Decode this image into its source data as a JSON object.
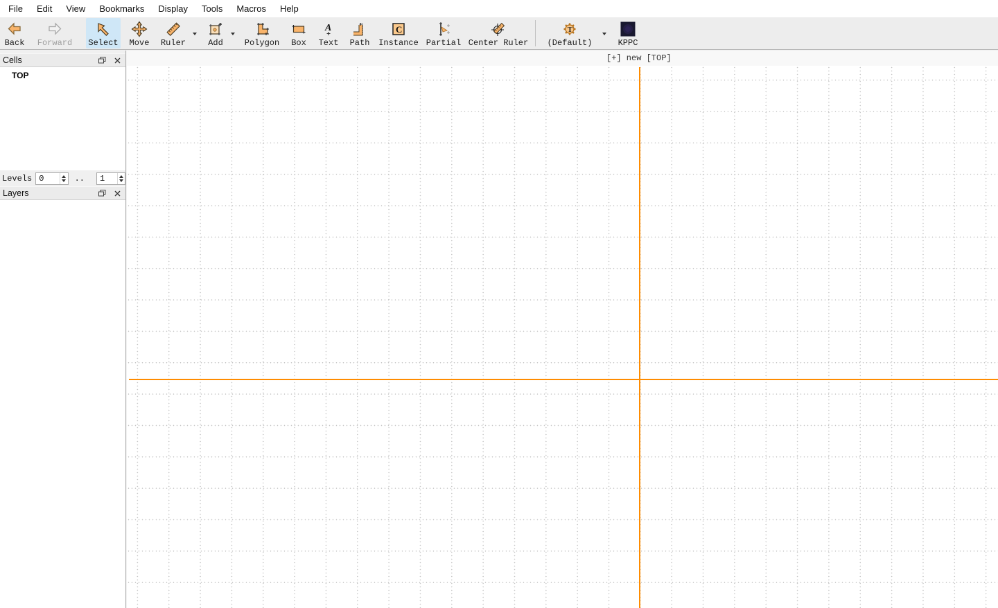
{
  "menu": {
    "items": [
      "File",
      "Edit",
      "View",
      "Bookmarks",
      "Display",
      "Tools",
      "Macros",
      "Help"
    ]
  },
  "toolbar": {
    "buttons": [
      {
        "id": "back",
        "label": "Back",
        "state": "enabled"
      },
      {
        "id": "forward",
        "label": "Forward",
        "state": "disabled"
      },
      {
        "id": "select",
        "label": "Select",
        "state": "active"
      },
      {
        "id": "move",
        "label": "Move",
        "state": "enabled"
      },
      {
        "id": "ruler",
        "label": "Ruler",
        "state": "enabled",
        "has_dropdown": true
      },
      {
        "id": "add",
        "label": "Add",
        "state": "enabled",
        "has_dropdown": true
      },
      {
        "id": "polygon",
        "label": "Polygon",
        "state": "enabled"
      },
      {
        "id": "box",
        "label": "Box",
        "state": "enabled"
      },
      {
        "id": "text",
        "label": "Text",
        "state": "enabled"
      },
      {
        "id": "path",
        "label": "Path",
        "state": "enabled"
      },
      {
        "id": "instance",
        "label": "Instance",
        "state": "enabled"
      },
      {
        "id": "partial",
        "label": "Partial",
        "state": "enabled"
      },
      {
        "id": "center-ruler",
        "label": "Center Ruler",
        "state": "enabled"
      },
      {
        "id": "default",
        "label": "(Default)",
        "state": "enabled",
        "has_dropdown": true
      },
      {
        "id": "kppc",
        "label": "KPPC",
        "state": "enabled"
      }
    ]
  },
  "panels": {
    "cells": {
      "title": "Cells",
      "items": [
        "TOP"
      ]
    },
    "levels": {
      "label": "Levels",
      "from_value": "0",
      "range_separator": "..",
      "to_value": "1"
    },
    "layers": {
      "title": "Layers",
      "items": []
    }
  },
  "canvas": {
    "tab_label": "[+] new [TOP]"
  },
  "colors": {
    "axis": "#ff8c00",
    "grid_dot": "#c6c6c6",
    "select_highlight": "#cfe7f7",
    "icon_orange": "#f9b46b"
  }
}
